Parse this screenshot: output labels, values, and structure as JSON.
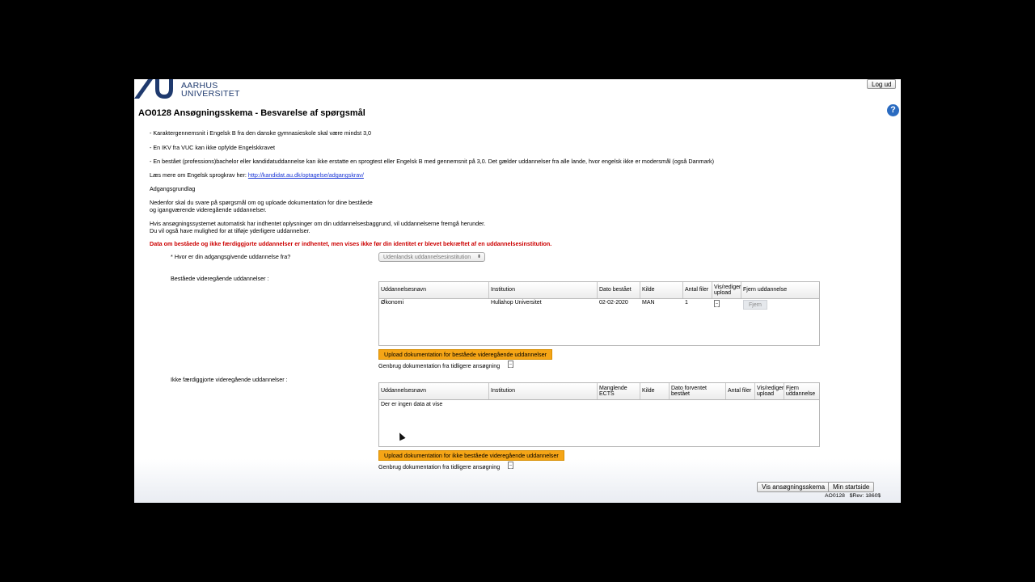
{
  "header": {
    "logo_line1": "AARHUS",
    "logo_line2": "UNIVERSITET",
    "logout_label": "Log ud",
    "help_label": "?"
  },
  "page_title": "AO0128 Ansøgningsskema - Besvarelse af spørgsmål",
  "intro": {
    "bullet1": "- Karaktergennemsnit i Engelsk B fra den danske gymnasieskole skal være mindst 3,0",
    "bullet2": "- En IKV fra VUC kan ikke opfylde Engelskkravet",
    "bullet3": "- En bestået (professions)bachelor eller kandidatuddannelse kan ikke erstatte en sprogtest eller Engelsk B med gennemsnit på 3,0. Det gælder uddannelser fra alle lande, hvor engelsk ikke er modersmål (også Danmark)",
    "read_more": "Læs mere om Engelsk sprogkrav her: ",
    "read_more_link": "http://kandidat.au.dk/optagelse/adgangskrav/",
    "section": "Adgangsgrundlag",
    "para1_line1": "Nedenfor skal du svare på spørgsmål om og uploade dokumentation for dine beståede",
    "para1_line2": "og igangværende videregående uddannelser.",
    "para2_line1": "Hvis ansøgningssystemet automatisk har indhentet oplysninger om din uddannelsesbaggrund, vil uddannelserne fremgå herunder.",
    "para2_line2": "Du vil også have mulighed for at tilføje yderligere uddannelser.",
    "warning": "Data om beståede og ikke færdiggjorte uddannelser er indhentet, men vises ikke før din identitet er blevet bekræftet af en uddannelsesinstitution."
  },
  "question": {
    "required_mark": "*",
    "label": "Hvor er din adgangsgivende uddannelse fra?",
    "selected": "Udenlandsk uddannelsesinstitution"
  },
  "completed": {
    "label": "Beståede videregående uddannelser :",
    "columns": [
      "Uddannelsesnavn",
      "Institution",
      "Dato bestået",
      "Kilde",
      "Antal filer",
      "Vis/rediger upload",
      "Fjern uddannelse"
    ],
    "rows": [
      {
        "name": "Økonomi",
        "institution": "Hullahop Universitet",
        "date": "02-02-2020",
        "source": "MAN",
        "files": "1",
        "remove_label": "Fjern"
      }
    ],
    "upload_label": "Upload dokumentation for beståede videregående uddannelser",
    "reuse_label": "Genbrug dokumentation fra tidligere ansøgning"
  },
  "incomplete": {
    "label": "Ikke færdiggjorte videregående uddannelser :",
    "columns": [
      "Uddannelsesnavn",
      "Institution",
      "Manglende ECTS",
      "Kilde",
      "Dato forventet bestået",
      "Antal filer",
      "Vis/rediger upload",
      "Fjern uddannelse"
    ],
    "empty_text": "Der er ingen data at vise",
    "upload_label": "Upload dokumentation for ikke beståede videregående uddannelser",
    "reuse_label": "Genbrug dokumentation fra tidligere ansøgning"
  },
  "footer": {
    "show_form_label": "Vis ansøgningsskema",
    "home_label": "Min startside",
    "code": "AO0128",
    "revision": "$Rev: 1860$"
  },
  "colors": {
    "accent": "#f5a516",
    "brand": "#1f3a6e",
    "warning": "#cc0000",
    "link": "#1a36d6"
  }
}
